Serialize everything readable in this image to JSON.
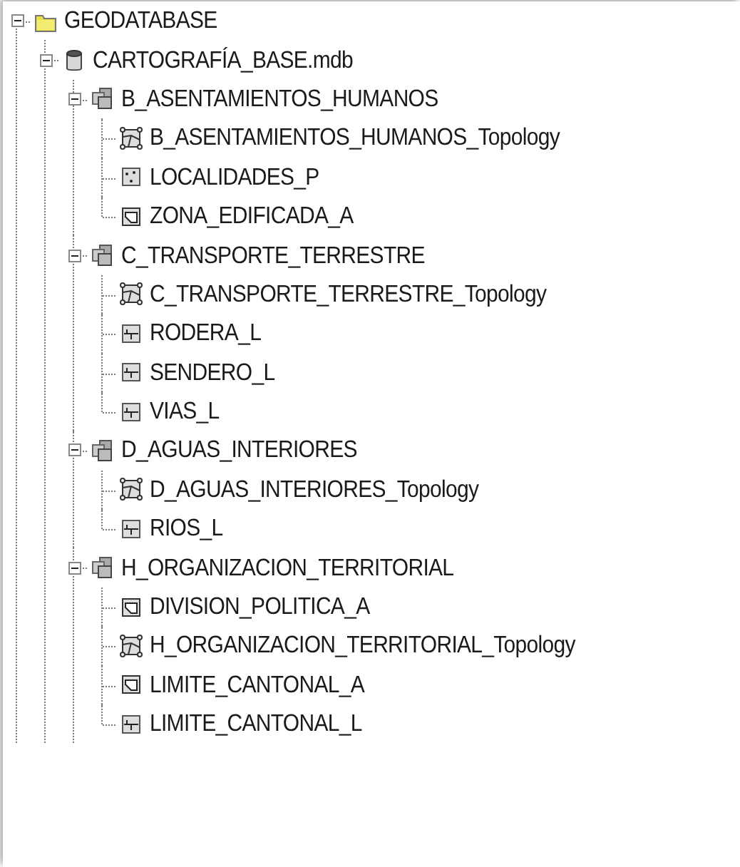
{
  "tree": [
    {
      "label": "GEODATABASE",
      "kind": "folder",
      "expanded": true,
      "children": [
        {
          "label": "CARTOGRAFÍA_BASE.mdb",
          "kind": "database",
          "expanded": true,
          "children": [
            {
              "label": "B_ASENTAMIENTOS_HUMANOS",
              "kind": "dataset",
              "expanded": true,
              "children": [
                {
                  "label": "B_ASENTAMIENTOS_HUMANOS_Topology",
                  "kind": "topology"
                },
                {
                  "label": "LOCALIDADES_P",
                  "kind": "point"
                },
                {
                  "label": "ZONA_EDIFICADA_A",
                  "kind": "polygon"
                }
              ]
            },
            {
              "label": "C_TRANSPORTE_TERRESTRE",
              "kind": "dataset",
              "expanded": true,
              "children": [
                {
                  "label": "C_TRANSPORTE_TERRESTRE_Topology",
                  "kind": "topology"
                },
                {
                  "label": "RODERA_L",
                  "kind": "line"
                },
                {
                  "label": "SENDERO_L",
                  "kind": "line"
                },
                {
                  "label": "VIAS_L",
                  "kind": "line"
                }
              ]
            },
            {
              "label": "D_AGUAS_INTERIORES",
              "kind": "dataset",
              "expanded": true,
              "children": [
                {
                  "label": "D_AGUAS_INTERIORES_Topology",
                  "kind": "topology"
                },
                {
                  "label": "RIOS_L",
                  "kind": "line"
                }
              ]
            },
            {
              "label": "H_ORGANIZACION_TERRITORIAL",
              "kind": "dataset",
              "expanded": true,
              "children": [
                {
                  "label": "DIVISION_POLITICA_A",
                  "kind": "polygon"
                },
                {
                  "label": "H_ORGANIZACION_TERRITORIAL_Topology",
                  "kind": "topology"
                },
                {
                  "label": "LIMITE_CANTONAL_A",
                  "kind": "polygon"
                },
                {
                  "label": "LIMITE_CANTONAL_L",
                  "kind": "line"
                }
              ]
            }
          ]
        }
      ]
    }
  ]
}
